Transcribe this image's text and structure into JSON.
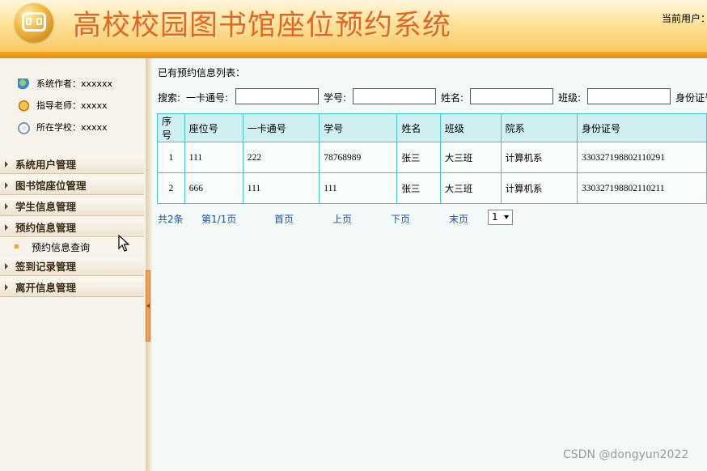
{
  "header": {
    "title": "高校校园图书馆座位预约系统",
    "current_user": "当前用户：a"
  },
  "sidebar": {
    "info": [
      {
        "icon": "users-icon",
        "text": "系统作者：xxxxxx"
      },
      {
        "icon": "teacher-icon",
        "text": "指导老师：xxxxx"
      },
      {
        "icon": "school-icon",
        "text": "所在学校：xxxxx"
      }
    ],
    "menu": [
      {
        "label": "系统用户管理"
      },
      {
        "label": "图书馆座位管理"
      },
      {
        "label": "学生信息管理"
      },
      {
        "label": "预约信息管理"
      },
      {
        "label": "签到记录管理"
      },
      {
        "label": "离开信息管理"
      }
    ],
    "submenu": {
      "label": "预约信息查询"
    }
  },
  "main": {
    "list_title": "已有预约信息列表：",
    "search": {
      "label": "搜索:",
      "card_label": "一卡通号:",
      "card_value": "",
      "student_no_label": "学号:",
      "student_no_value": "",
      "name_label": "姓名:",
      "name_value": "",
      "class_label": "班级:",
      "class_value": "",
      "id_label": "身份证号"
    },
    "table": {
      "headers": [
        "序号",
        "座位号",
        "一卡通号",
        "学号",
        "姓名",
        "班级",
        "院系",
        "身份证号"
      ],
      "rows": [
        [
          "1",
          "111",
          "222",
          "78768989",
          "张三",
          "大三班",
          "计算机系",
          "330327198802110291"
        ],
        [
          "2",
          "666",
          "111",
          "111",
          "张三",
          "大三班",
          "计算机系",
          "330327198802110211"
        ]
      ]
    },
    "pager": {
      "total": "共2条",
      "page_info": "第1/1页",
      "first": "首页",
      "prev": "上页",
      "next": "下页",
      "last": "末页",
      "selected_page": "1"
    }
  },
  "watermark": "CSDN @dongyun2022"
}
